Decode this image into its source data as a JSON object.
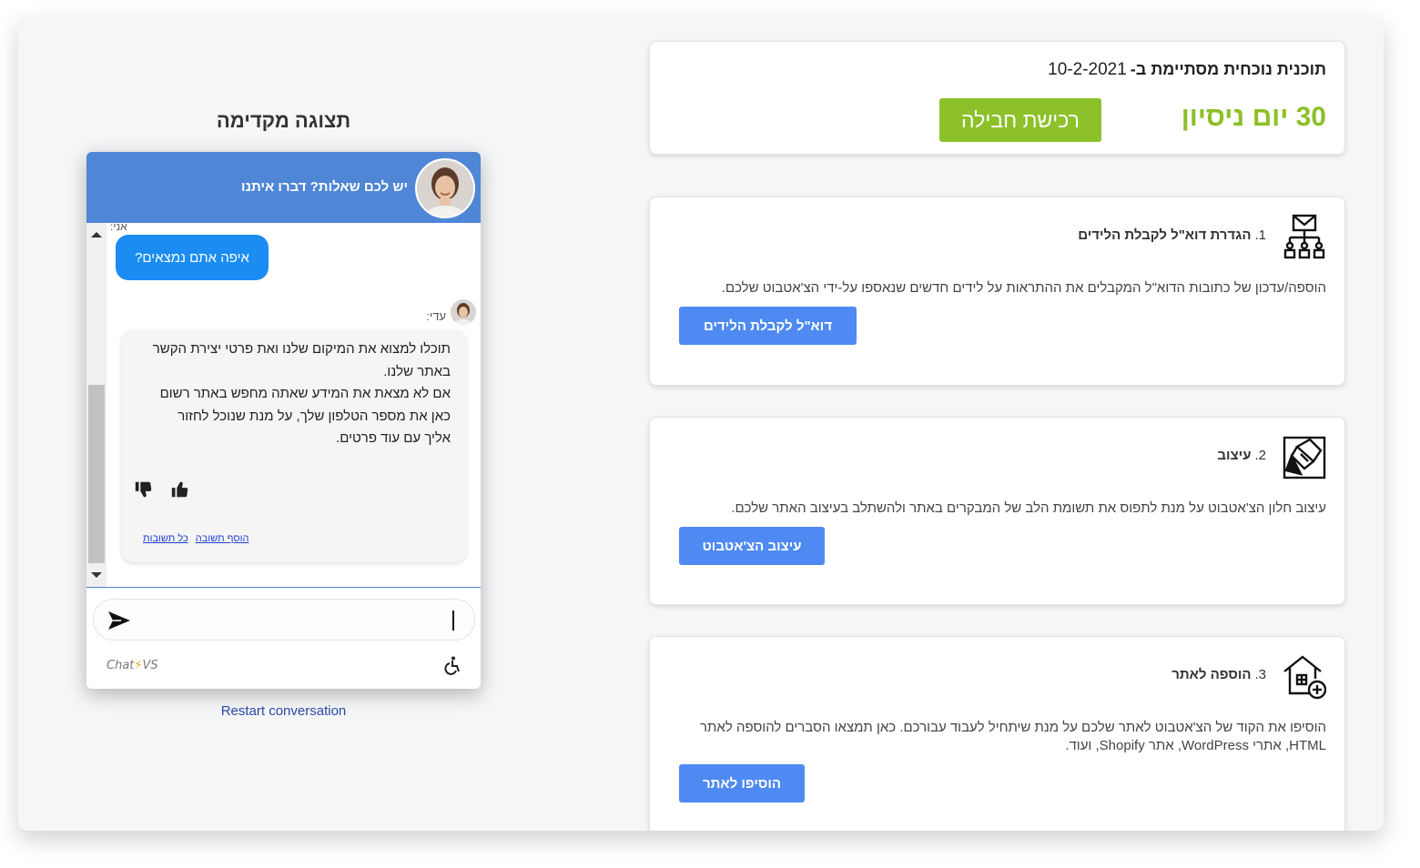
{
  "plan": {
    "label": "תוכנית נוכחית מסתיימת ב-",
    "end_date": "10-2-2021",
    "trial_text": "30 יום ניסיון",
    "buy_label": "רכישת חבילה"
  },
  "steps": [
    {
      "number": "1.",
      "title": "הגדרת דוא\"ל לקבלת הלידים",
      "description": "הוספה/עדכון של כתובות הדוא\"ל המקבלים את ההתראות על לידים חדשים שנאספו על-ידי הצ'אטבוט שלכם.",
      "button": "דוא\"ל לקבלת הלידים",
      "icon": "email-hierarchy-icon"
    },
    {
      "number": "2.",
      "title": "עיצוב",
      "description": "עיצוב חלון הצ'אטבוט על מנת לתפוס את תשומת הלב של המבקרים באתר ולהשתלב בעיצוב האתר שלכם.",
      "button": "עיצוב הצ'אטבוט",
      "icon": "design-brush-icon"
    },
    {
      "number": "3.",
      "title": "הוספה לאתר",
      "description": "הוסיפו את הקוד של הצ'אטבוט לאתר שלכם על מנת שיתחיל לעבוד עבורכם. כאן תמצאו הסברים להוספה לאתר HTML, אתרי WordPress, אתר Shopify, ועוד.",
      "button": "הוסיפו לאתר",
      "icon": "house-add-icon"
    }
  ],
  "preview": {
    "title": "תצוגה מקדימה",
    "header_text": "יש לכם שאלות? דברו איתנו",
    "me_label": "אני:",
    "user_message": "איפה אתם נמצאים?",
    "bot_name": "עדי:",
    "bot_message_lines": [
      "תוכלו למצוא את המיקום שלנו ואת פרטי יצירת הקשר",
      "באתר שלנו.",
      "אם לא מצאת את המידע שאתה מחפש באתר רשום",
      "כאן את מספר הטלפון שלך, על מנת שנוכל לחזור",
      "אליך עם עוד פרטים."
    ],
    "add_answer": "הוסף תשובה",
    "all_answers": "כל תשובות",
    "brand_left": "Chat",
    "brand_bolt": "⚡",
    "brand_right": "VS",
    "restart": "Restart conversation"
  },
  "colors": {
    "accent_blue": "#4e8af2",
    "trial_green": "#8cbf26",
    "buy_green": "#8cc12a",
    "chat_header": "#4f86d6",
    "user_bubble": "#1a8cf2"
  }
}
